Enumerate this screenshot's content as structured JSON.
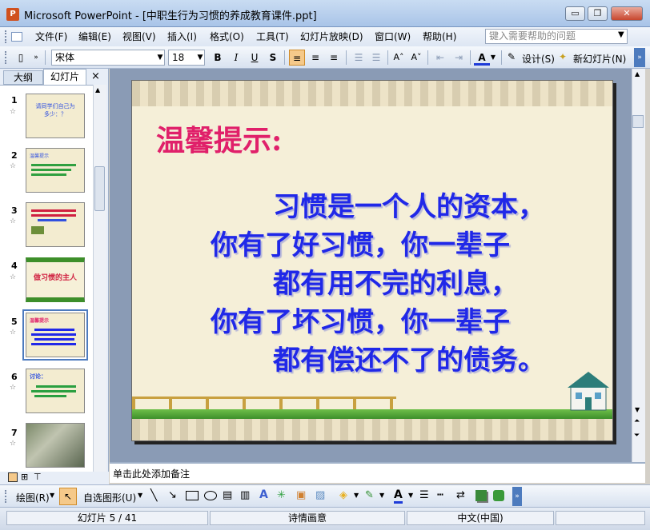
{
  "window": {
    "title": "Microsoft PowerPoint - [中职生行为习惯的养成教育课件.ppt]",
    "app_icon": "P",
    "controls": {
      "minimize": "▭",
      "restore": "❐",
      "close": "✕"
    }
  },
  "menubar": {
    "items": [
      "文件(F)",
      "编辑(E)",
      "视图(V)",
      "插入(I)",
      "格式(O)",
      "工具(T)",
      "幻灯片放映(D)",
      "窗口(W)",
      "帮助(H)"
    ],
    "help_placeholder": "键入需要帮助的问题"
  },
  "toolbar": {
    "font_name": "宋体",
    "font_size": "18",
    "bold": "B",
    "italic": "I",
    "underline": "U",
    "shadow": "S",
    "increase_font": "A˄",
    "decrease_font": "A˅",
    "font_color": "A",
    "design_label": "设计(S)",
    "new_slide_label": "新幻灯片(N)"
  },
  "panel": {
    "tab_outline": "大纲",
    "tab_slides": "幻灯片",
    "close": "×",
    "thumbnails": [
      {
        "num": "1",
        "text": "请同学们自己为\n多少：？"
      },
      {
        "num": "2",
        "text": "温馨提示"
      },
      {
        "num": "3",
        "text": ""
      },
      {
        "num": "4",
        "text": "做习惯的主人"
      },
      {
        "num": "5",
        "text": "温馨提示"
      },
      {
        "num": "6",
        "text": "讨论："
      },
      {
        "num": "7",
        "text": ""
      }
    ],
    "selected": 5
  },
  "slide": {
    "title": "温馨提示:",
    "lines": [
      "习惯是一个人的资本，",
      "你有了好习惯，你一辈子",
      "都有用不完的利息，",
      "你有了坏习惯，你一辈子",
      "都有偿还不了的债务。"
    ],
    "colors": {
      "title": "#e0206a",
      "body": "#2028e8",
      "background": "#f5efd8"
    }
  },
  "notes": {
    "placeholder": "单击此处添加备注"
  },
  "drawbar": {
    "draw_label": "绘图(R)",
    "autoshapes_label": "自选图形(U)"
  },
  "status": {
    "slide_info": "幻灯片 5 / 41",
    "design_name": "诗情画意",
    "language": "中文(中国)"
  }
}
